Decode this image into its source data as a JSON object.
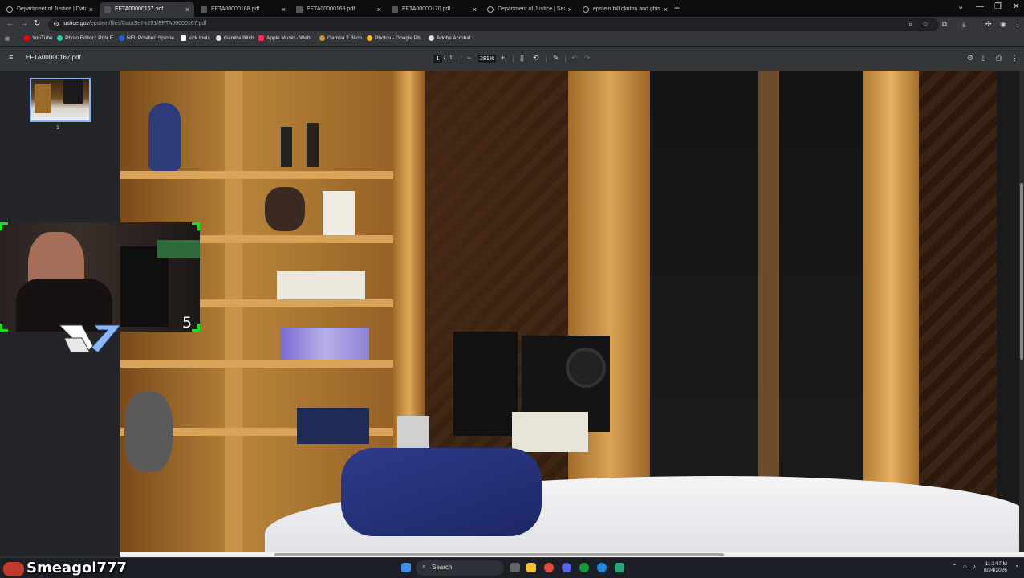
{
  "browser": {
    "tabs": [
      {
        "label": "Department of Justice | Data S",
        "active": false
      },
      {
        "label": "EFTA00000167.pdf",
        "active": true
      },
      {
        "label": "EFTA00000168.pdf",
        "active": false
      },
      {
        "label": "EFTA00000169.pdf",
        "active": false
      },
      {
        "label": "EFTA00000170.pdf",
        "active": false
      },
      {
        "label": "Department of Justice | Search",
        "active": false
      },
      {
        "label": "epstein bill clinton and ghislain",
        "active": false
      }
    ],
    "new_tab_glyph": "+",
    "close_glyph": "×",
    "window_controls": [
      "⌄",
      "—",
      "❐",
      "✕"
    ],
    "address": {
      "domain": "justice.gov",
      "path": "/epstein/files/DataSet%201/EFTA00000167.pdf"
    },
    "nav_icons": [
      "back-icon",
      "forward-icon",
      "reload-icon"
    ],
    "bookmarks": [
      {
        "label": "YouTube",
        "color": "#ff0000"
      },
      {
        "label": "Photo Editor : Pixlr E...",
        "color": "#2ec4b6"
      },
      {
        "label": "NFL Position Spinne...",
        "color": "#1e63d6"
      },
      {
        "label": "kick tools",
        "color": "#ffffff"
      },
      {
        "label": "Gamba Bitch",
        "color": "#dddddd"
      },
      {
        "label": "Apple Music - Web...",
        "color": "#fa2d55"
      },
      {
        "label": "Gamba 2 Bitch",
        "color": "#c99a2e"
      },
      {
        "label": "Photos - Google Ph...",
        "color": "#fbbc04"
      },
      {
        "label": "Adobe Acrobat",
        "color": "#dddddd"
      }
    ]
  },
  "pdf": {
    "filename": "EFTA00000167.pdf",
    "page_current": "1",
    "page_separator": "/",
    "page_total": "1",
    "zoom": "381%",
    "thumbnail_page": "1"
  },
  "stream": {
    "camera_number": "5",
    "username": "Smeagol777"
  },
  "taskbar": {
    "search_placeholder": "Search",
    "time": "11:14 PM",
    "date": "8/24/2026"
  },
  "colors": {
    "accent": "#8ab4f8",
    "camera_frame": "#19e01f"
  }
}
